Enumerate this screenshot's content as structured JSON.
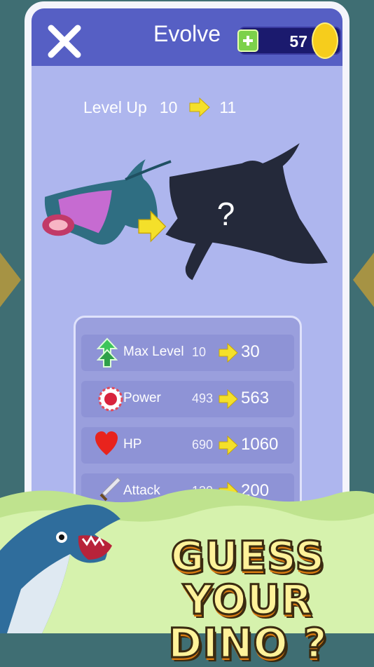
{
  "header": {
    "title": "Evolve",
    "close_icon": "close-x-icon",
    "currency": {
      "value": "57",
      "plus_icon": "add-currency-icon",
      "coin_icon": "gold-coin-icon"
    }
  },
  "level_up": {
    "label": "Level Up",
    "from": "10",
    "to": "11"
  },
  "creatures": {
    "current_icon": "manta-ray-creature",
    "next_icon": "locked-silhouette-creature",
    "mystery_mark": "?"
  },
  "stats": [
    {
      "label": "Max Level",
      "from": "10",
      "to": "30",
      "icon": "level-up-icon"
    },
    {
      "label": "Power",
      "from": "493",
      "to": "563",
      "icon": "power-icon"
    },
    {
      "label": "HP",
      "from": "690",
      "to": "1060",
      "icon": "heart-icon"
    },
    {
      "label": "Attack",
      "from": "130",
      "to": "200",
      "icon": "sword-icon"
    }
  ],
  "banner": {
    "line1": "GUESS YOUR",
    "line2": "DINO ?"
  },
  "colors": {
    "panel": "#aeb6ee",
    "header": "#565fc4",
    "arrow": "#f4e02a",
    "banner_grass": "#c9ec9c"
  }
}
